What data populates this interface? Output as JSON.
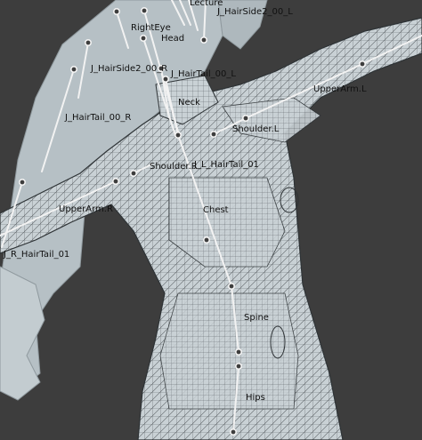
{
  "viewport": {
    "background": "#3d3d3d",
    "mesh_fill": "#c9d1d5",
    "hair_fill": "#b9c3c8",
    "wire_color": "#3a3f42",
    "bone_color": "#f2f2f2"
  },
  "labels": {
    "lecture": "Lecture",
    "hairside2_l": "J_HairSide2_00_L",
    "righteye": "RightEye",
    "head": "Head",
    "hairside2_r": "J_HairSide2_00_R",
    "hairtail_l": "J_HairTail_00_L",
    "hairtail_r": "J_HairTail_00_R",
    "neck": "Neck",
    "upperarm_l": "UpperArm.L",
    "shoulder_l": "Shoulder.L",
    "shoulder_r": "Shoulder.R",
    "l_hairtail_01": "J_L_HairTail_01",
    "chest": "Chest",
    "upperarm_r": "UpperArm.R",
    "r_hairtail_01": "J_R_HairTail_01",
    "spine": "Spine",
    "hips": "Hips"
  }
}
